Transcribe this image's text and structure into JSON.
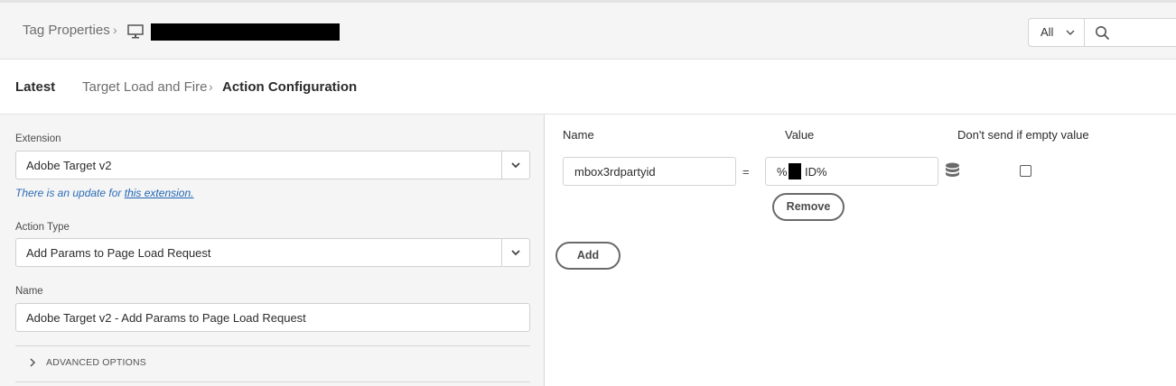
{
  "header": {
    "root_crumb": "Tag Properties",
    "separator": "›",
    "property_icon": "monitor-icon",
    "property_name": "[redacted]",
    "filter_label": "All",
    "filter_icon": "chevron-down-icon",
    "search_icon": "search-icon"
  },
  "subheader": {
    "version": "Latest",
    "rule": "Target Load and Fire",
    "separator": "›",
    "current": "Action Configuration"
  },
  "config": {
    "extension_label": "Extension",
    "extension_value": "Adobe Target v2",
    "update_text": "There is an update for ",
    "update_link": "this extension.",
    "action_type_label": "Action Type",
    "action_type_value": "Add Params to Page Load Request",
    "name_label": "Name",
    "name_value": "Adobe Target v2 - Add Params to Page Load Request",
    "advanced_options": "ADVANCED OPTIONS"
  },
  "params": {
    "headers": {
      "name": "Name",
      "value": "Value",
      "dont_send": "Don't send if empty value"
    },
    "rows": [
      {
        "name": "mbox3rdpartyid",
        "equals": "=",
        "value_prefix": "%",
        "value_suffix": "ID%",
        "data_element_icon": "database-icon",
        "dont_send": false,
        "remove_label": "Remove"
      }
    ],
    "add_label": "Add"
  },
  "colors": {
    "link": "#1f63b3",
    "pane_bg": "#f5f5f5",
    "button_border": "#6a6a6a"
  }
}
